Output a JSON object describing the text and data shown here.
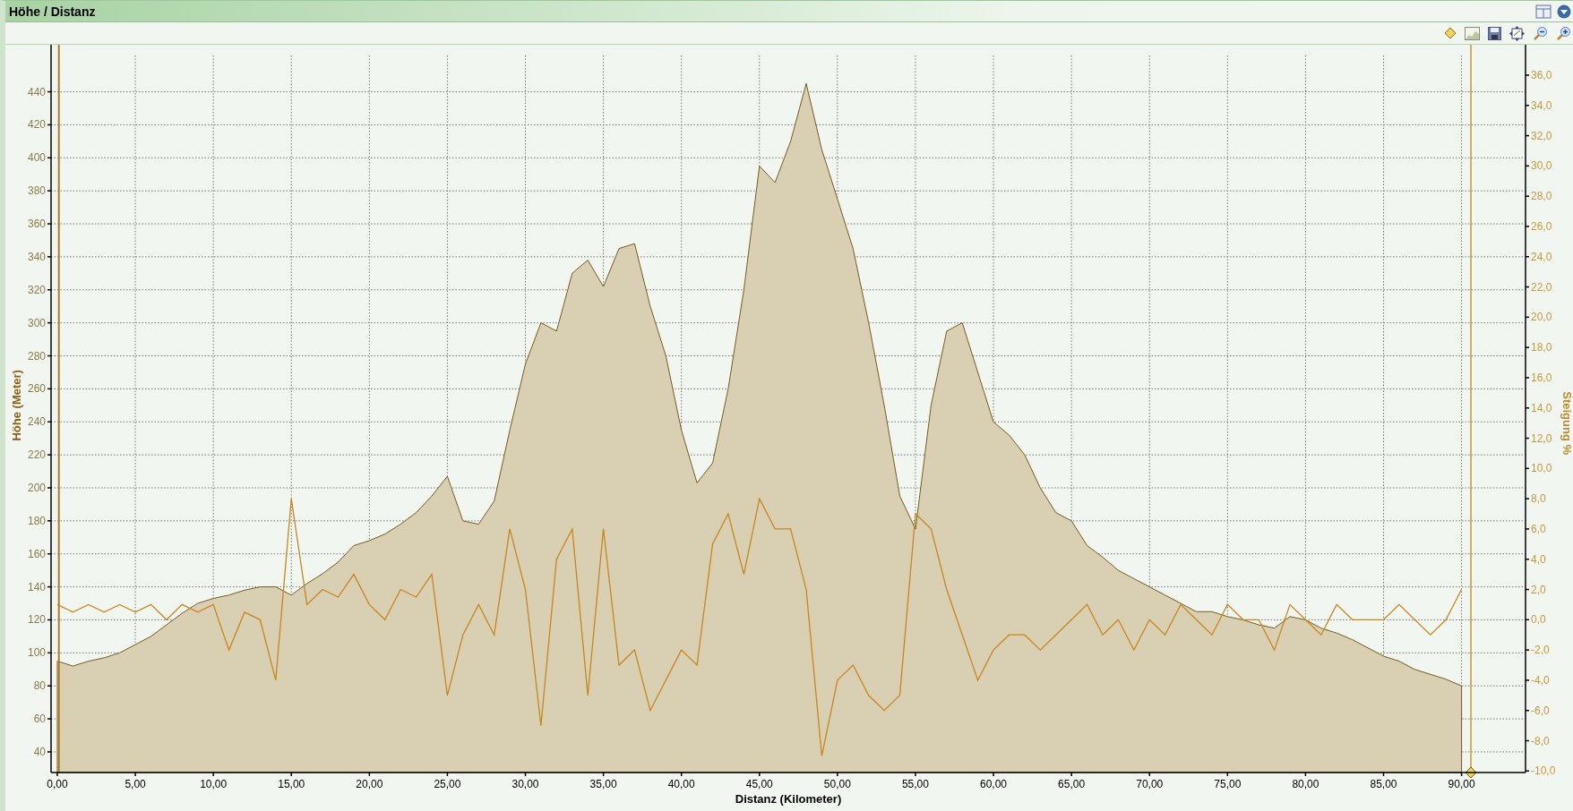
{
  "panel": {
    "title": "Höhe / Distanz"
  },
  "chart_data": {
    "type": "area",
    "xlabel": "Distanz (Kilometer)",
    "ylabel": "Höhe (Meter)",
    "y2label": "Steigung %",
    "x": [
      0,
      1,
      2,
      3,
      4,
      5,
      6,
      7,
      8,
      9,
      10,
      11,
      12,
      13,
      14,
      15,
      16,
      17,
      18,
      19,
      20,
      21,
      22,
      23,
      24,
      25,
      26,
      27,
      28,
      29,
      30,
      31,
      32,
      33,
      34,
      35,
      36,
      37,
      38,
      39,
      40,
      41,
      42,
      43,
      44,
      45,
      46,
      47,
      48,
      49,
      50,
      51,
      52,
      53,
      54,
      55,
      56,
      57,
      58,
      59,
      60,
      61,
      62,
      63,
      64,
      65,
      66,
      67,
      68,
      69,
      70,
      71,
      72,
      73,
      74,
      75,
      76,
      77,
      78,
      79,
      80,
      81,
      82,
      83,
      84,
      85,
      86,
      87,
      88,
      89,
      90
    ],
    "series": [
      {
        "color": "#d9cfb2",
        "values": [
          95,
          92,
          95,
          97,
          100,
          105,
          110,
          117,
          124,
          130,
          133,
          135,
          138,
          140,
          140,
          135,
          142,
          148,
          155,
          165,
          168,
          172,
          178,
          185,
          195,
          207,
          180,
          178,
          192,
          235,
          275,
          300,
          295,
          330,
          338,
          322,
          345,
          348,
          310,
          280,
          235,
          203,
          215,
          260,
          320,
          395,
          385,
          410,
          445,
          405,
          375,
          345,
          300,
          250,
          195,
          175,
          250,
          295,
          300,
          270,
          240,
          232,
          220,
          200,
          185,
          180,
          165,
          158,
          150,
          145,
          140,
          135,
          130,
          125,
          125,
          122,
          120,
          117,
          115,
          122,
          120,
          115,
          112,
          108,
          103,
          98,
          95,
          90,
          87,
          84,
          80
        ]
      },
      {
        "type": "line",
        "axis": "y2",
        "color": "#c8861e",
        "values": [
          1,
          0.5,
          1,
          0.5,
          1,
          0.5,
          1,
          0,
          1,
          0.5,
          1,
          -2,
          0.5,
          0,
          -4,
          8,
          1,
          2,
          1.5,
          3,
          1,
          0,
          2,
          1.5,
          3,
          -5,
          -1,
          1,
          -1,
          6,
          2,
          -7,
          4,
          6,
          -5,
          6,
          -3,
          -2,
          -6,
          -4,
          -2,
          -3,
          5,
          7,
          3,
          8,
          6,
          6,
          2,
          -9,
          -4,
          -3,
          -5,
          -6,
          -5,
          7,
          6,
          2,
          -1,
          -4,
          -2,
          -1,
          -1,
          -2,
          -1,
          0,
          1,
          -1,
          0,
          -2,
          0,
          -1,
          1,
          0,
          -1,
          1,
          0,
          0,
          -2,
          1,
          0,
          -1,
          1,
          0,
          0,
          0,
          1,
          0,
          -1,
          0,
          2
        ]
      }
    ],
    "xlim": [
      -0.4,
      94.1
    ],
    "ylim": [
      27.5,
      462
    ],
    "y2lim": [
      -10.1,
      37.3
    ],
    "xticks": [
      {
        "value": 0,
        "label": "0,00"
      },
      {
        "value": 5,
        "label": "5,00"
      },
      {
        "value": 10,
        "label": "10,00"
      },
      {
        "value": 15,
        "label": "15,00"
      },
      {
        "value": 20,
        "label": "20,00"
      },
      {
        "value": 25,
        "label": "25,00"
      },
      {
        "value": 30,
        "label": "30,00"
      },
      {
        "value": 35,
        "label": "35,00"
      },
      {
        "value": 40,
        "label": "40,00"
      },
      {
        "value": 45,
        "label": "45,00"
      },
      {
        "value": 50,
        "label": "50,00"
      },
      {
        "value": 55,
        "label": "55,00"
      },
      {
        "value": 60,
        "label": "60,00"
      },
      {
        "value": 65,
        "label": "65,00"
      },
      {
        "value": 70,
        "label": "70,00"
      },
      {
        "value": 75,
        "label": "75,00"
      },
      {
        "value": 80,
        "label": "80,00"
      },
      {
        "value": 85,
        "label": "85,00"
      },
      {
        "value": 90,
        "label": "90,00"
      }
    ],
    "yticks": [
      440,
      420,
      400,
      380,
      360,
      340,
      320,
      300,
      280,
      260,
      240,
      220,
      200,
      180,
      160,
      140,
      120,
      100,
      80,
      60,
      40
    ],
    "y2ticks": [
      {
        "value": 36,
        "label": "36,0"
      },
      {
        "value": 34,
        "label": "34,0"
      },
      {
        "value": 32,
        "label": "32,0"
      },
      {
        "value": 30,
        "label": "30,0"
      },
      {
        "value": 28,
        "label": "28,0"
      },
      {
        "value": 26,
        "label": "26,0"
      },
      {
        "value": 24,
        "label": "24,0"
      },
      {
        "value": 22,
        "label": "22,0"
      },
      {
        "value": 20,
        "label": "20,0"
      },
      {
        "value": 18,
        "label": "18,0"
      },
      {
        "value": 16,
        "label": "16,0"
      },
      {
        "value": 14,
        "label": "14,0"
      },
      {
        "value": 12,
        "label": "12,0"
      },
      {
        "value": 10,
        "label": "10,0"
      },
      {
        "value": 8,
        "label": "8,0"
      },
      {
        "value": 6,
        "label": "6,0"
      },
      {
        "value": 4,
        "label": "4,0"
      },
      {
        "value": 2,
        "label": "2,0"
      },
      {
        "value": 0,
        "label": "0,0"
      },
      {
        "value": -2,
        "label": "-2,0"
      },
      {
        "value": -4,
        "label": "-4,0"
      },
      {
        "value": -6,
        "label": "-6,0"
      },
      {
        "value": -8,
        "label": "-8,0"
      },
      {
        "value": -10,
        "label": "-10,0"
      }
    ],
    "grid": true,
    "ref_lines": [
      {
        "axis": "x",
        "value": 0.1,
        "color": "#b07a28"
      },
      {
        "axis": "x",
        "value": 90.6,
        "color": "#c8963c"
      }
    ]
  }
}
